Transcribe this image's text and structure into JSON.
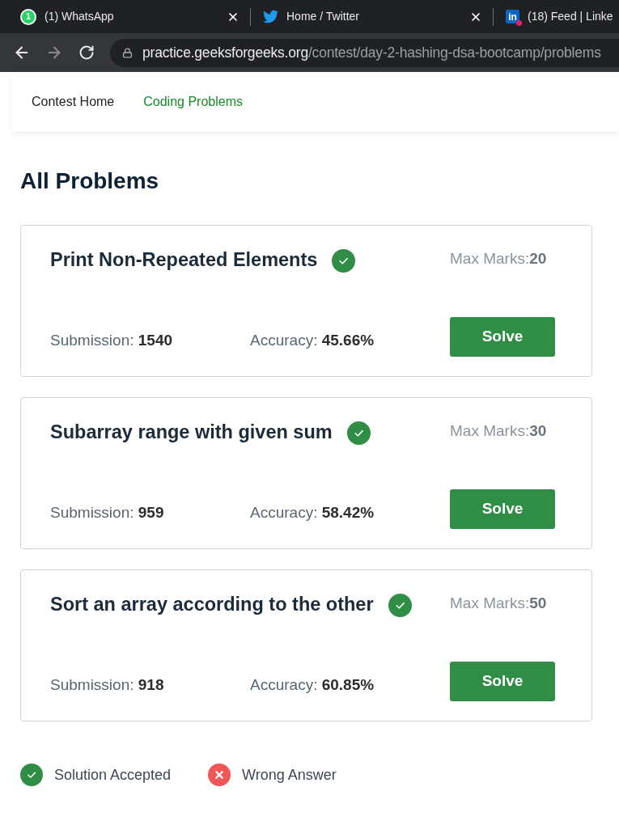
{
  "browser": {
    "tabs": [
      {
        "kind": "whatsapp",
        "badge": "1",
        "title": "(1) WhatsApp",
        "close_button": true
      },
      {
        "kind": "twitter",
        "title": "Home / Twitter",
        "close_button": true
      },
      {
        "kind": "linkedin",
        "logo": "in",
        "title": "(18) Feed | Linke",
        "close_button": false
      }
    ],
    "nav_buttons": [
      {
        "kind": "back",
        "disabled": false
      },
      {
        "kind": "forward",
        "disabled": true
      },
      {
        "kind": "reload",
        "disabled": false
      }
    ],
    "address": {
      "host": "practice.geeksforgeeks.org",
      "path": "/contest/day-2-hashing-dsa-bootcamp/problems"
    }
  },
  "nav": {
    "items": [
      {
        "label": "Contest Home",
        "selected": false
      },
      {
        "label": "Coding Problems",
        "selected": true
      }
    ]
  },
  "heading": "All Problems",
  "problems": [
    {
      "title": "Print Non-Repeated Elements",
      "accepted": true,
      "max_marks_label": "Max Marks:",
      "max_marks": "20",
      "submission_label": "Submission:",
      "submissions": "1540",
      "accuracy_label": "Accuracy:",
      "accuracy": "45.66%",
      "action": "Solve"
    },
    {
      "title": "Subarray range with given sum",
      "accepted": true,
      "max_marks_label": "Max Marks:",
      "max_marks": "30",
      "submission_label": "Submission:",
      "submissions": "959",
      "accuracy_label": "Accuracy:",
      "accuracy": "58.42%",
      "action": "Solve"
    },
    {
      "title": "Sort an array according to the other",
      "accepted": true,
      "max_marks_label": "Max Marks:",
      "max_marks": "50",
      "submission_label": "Submission:",
      "submissions": "918",
      "accuracy_label": "Accuracy:",
      "accuracy": "60.85%",
      "action": "Solve"
    }
  ],
  "legend": [
    {
      "kind": "accepted",
      "label": "Solution Accepted"
    },
    {
      "kind": "wrong",
      "label": "Wrong Answer"
    }
  ]
}
